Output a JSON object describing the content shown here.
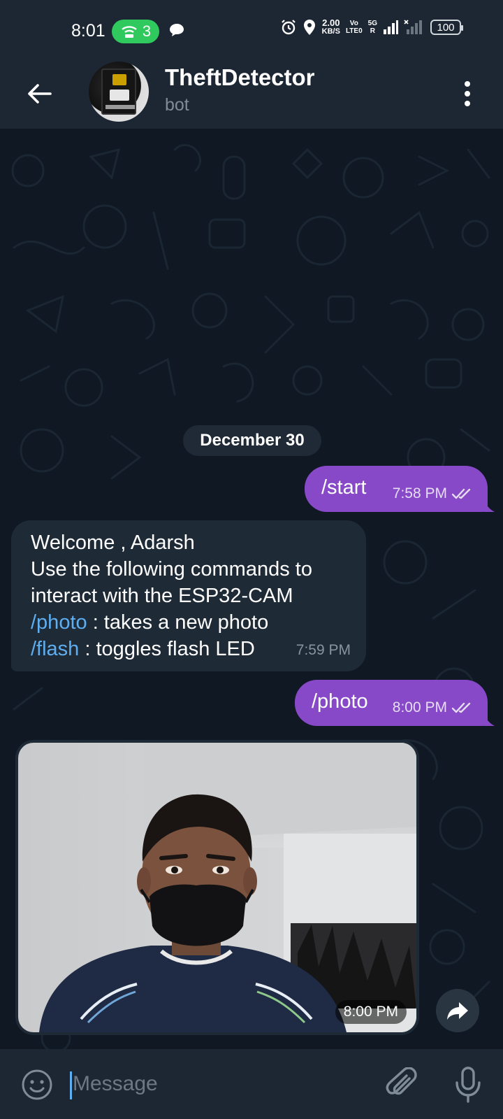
{
  "status_bar": {
    "time": "8:01",
    "hotspot_count": "3",
    "net_speed_value": "2.00",
    "net_speed_unit": "KB/S",
    "volte_top": "Vo",
    "volte_bottom": "LTE0",
    "network_type": "5G",
    "roaming": "R",
    "battery": "100",
    "icons": [
      "hotspot-icon",
      "chat-icon",
      "alarm-icon",
      "location-icon",
      "signal-icon",
      "no-signal-icon",
      "battery-icon"
    ]
  },
  "header": {
    "title": "TheftDetector",
    "subtitle": "bot"
  },
  "chat": {
    "date_separator": "December 30",
    "messages": [
      {
        "direction": "out",
        "text": "/start",
        "time": "7:58 PM",
        "read": true
      },
      {
        "direction": "in",
        "lines": [
          {
            "text": "Welcome , Adarsh"
          },
          {
            "text": "Use the following commands to"
          },
          {
            "text": "interact with the ESP32-CAM"
          },
          {
            "cmd": "/photo",
            "text": " : takes a new photo"
          },
          {
            "cmd": "/flash",
            "text": " : toggles flash LED"
          }
        ],
        "time": "7:59 PM"
      },
      {
        "direction": "out",
        "text": "/photo",
        "time": "8:00 PM",
        "read": true
      },
      {
        "direction": "in",
        "type": "photo",
        "time": "8:00 PM"
      }
    ]
  },
  "input": {
    "placeholder": "Message"
  },
  "colors": {
    "accent": "#8749c8",
    "background": "#0f1823",
    "header": "#1d2733",
    "incoming_bubble": "#1f2a37",
    "link": "#5eaef0"
  }
}
